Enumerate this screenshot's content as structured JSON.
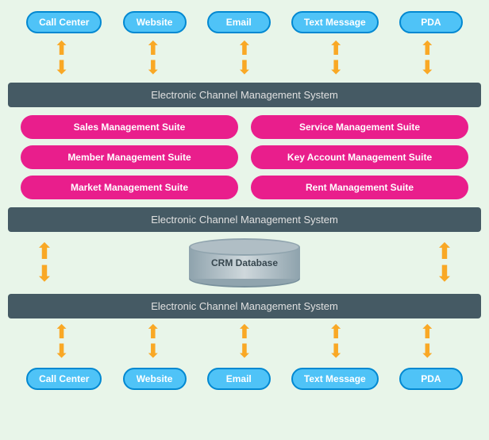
{
  "topChannels": [
    {
      "label": "Call Center"
    },
    {
      "label": "Website"
    },
    {
      "label": "Email"
    },
    {
      "label": "Text Message"
    },
    {
      "label": "PDA"
    }
  ],
  "bottomChannels": [
    {
      "label": "Call Center"
    },
    {
      "label": "Website"
    },
    {
      "label": "Email"
    },
    {
      "label": "Text Message"
    },
    {
      "label": "PDA"
    }
  ],
  "darkBar1": "Electronic Channel Management System",
  "darkBar2": "Electronic Channel Management System",
  "darkBar3": "Electronic Channel Management System",
  "suites": [
    [
      {
        "label": "Sales Management Suite"
      },
      {
        "label": "Service Management Suite"
      }
    ],
    [
      {
        "label": "Member Management Suite"
      },
      {
        "label": "Key Account Management Suite"
      }
    ],
    [
      {
        "label": "Market Management Suite"
      },
      {
        "label": "Rent Management Suite"
      }
    ]
  ],
  "crmLabel": "CRM Database",
  "arrows": {
    "updown": "⬆⬇",
    "up": "▲",
    "down": "▼"
  }
}
